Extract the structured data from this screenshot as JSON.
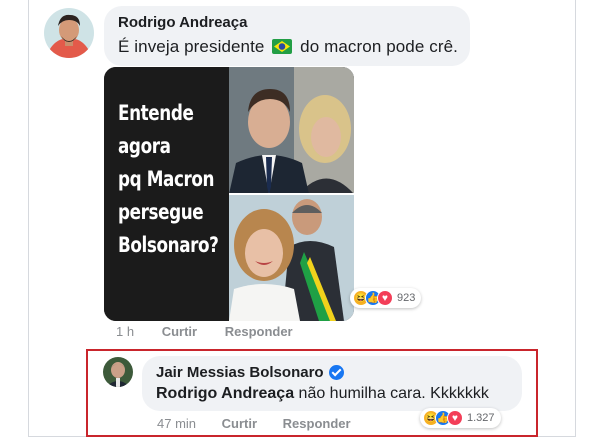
{
  "comment1": {
    "author": "Rodrigo Andreaça",
    "text_before": "É inveja presidente",
    "flag_icon": "brazil-flag-icon",
    "text_after": "do macron pode crê.",
    "meme_lines": [
      "Entende",
      "agora",
      "pq Macron",
      "persegue",
      "Bolsonaro?"
    ],
    "time": "1 h",
    "like_label": "Curtir",
    "reply_label": "Responder",
    "reaction_count": "923",
    "reactions": [
      "haha",
      "like",
      "love"
    ]
  },
  "comment2": {
    "author": "Jair Messias Bolsonaro",
    "verified_icon": "verified-badge-icon",
    "mention": "Rodrigo Andreaça",
    "text": " não humilha cara. Kkkkkkk",
    "time": "47 min",
    "like_label": "Curtir",
    "reply_label": "Responder",
    "reaction_count": "1.327",
    "reactions": [
      "haha",
      "like",
      "love"
    ]
  },
  "colors": {
    "bubble": "#f0f2f5",
    "highlight_border": "#c9252c",
    "like_blue": "#1877f2",
    "love_red": "#f33e58",
    "haha_yellow": "#f7b125",
    "meta_gray": "#8a8d91"
  }
}
